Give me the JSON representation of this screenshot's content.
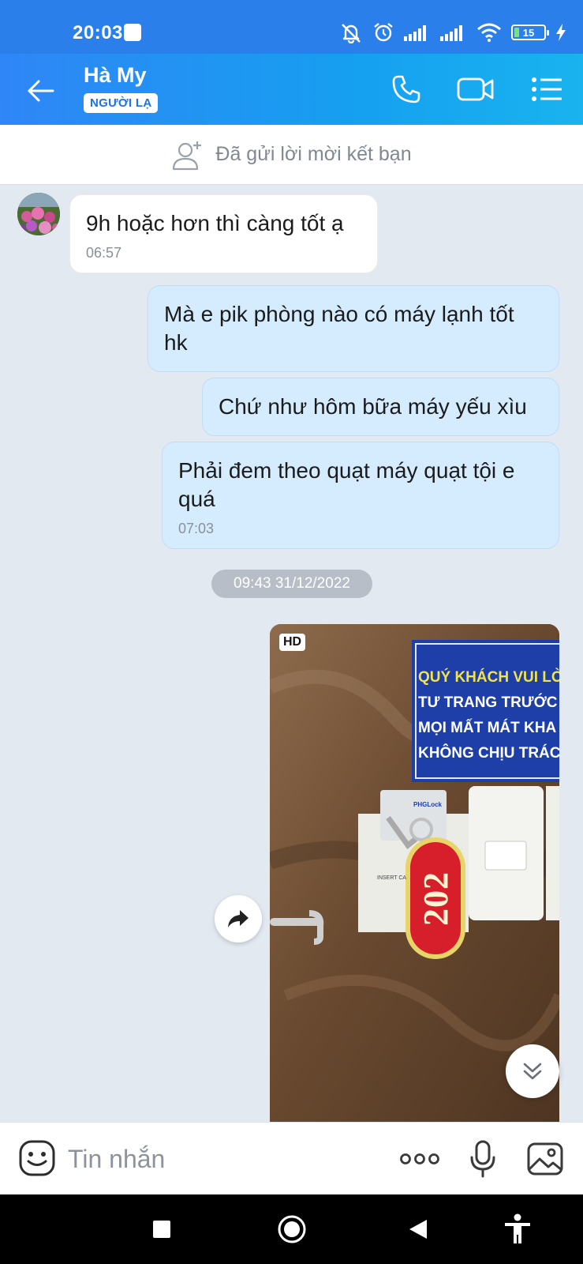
{
  "status_bar": {
    "time": "20:03",
    "battery_level": "15",
    "battery_fraction": 0.15,
    "icons": [
      "notifications-off-icon",
      "alarm-icon",
      "signal-icon",
      "signal-icon",
      "wifi-icon",
      "battery-icon",
      "charging-icon"
    ]
  },
  "header": {
    "contact_name": "Hà My",
    "badge": "NGƯỜI LẠ",
    "icons": [
      "back-arrow-icon",
      "phone-icon",
      "video-call-icon",
      "menu-list-icon"
    ]
  },
  "friend_request": {
    "text": "Đã gửi lời mời kết bạn",
    "icon": "add-friend-icon"
  },
  "messages": [
    {
      "direction": "incoming",
      "text": "9h hoặc hơn thì càng tốt ạ",
      "time": "06:57"
    },
    {
      "direction": "outgoing",
      "text": "Mà e pik phòng nào có máy lạnh tốt hk",
      "time": ""
    },
    {
      "direction": "outgoing",
      "text": "Chứ như hôm bữa máy yếu xìu",
      "time": ""
    },
    {
      "direction": "outgoing",
      "text": "Phải đem theo quạt máy quạt tội e quá",
      "time": "07:03"
    }
  ],
  "date_separator": "09:43 31/12/2022",
  "photo": {
    "hd_label": "HD",
    "sign_lines": [
      "QUÝ KHÁCH VUI LÒN",
      "TƯ TRANG TRƯỚC KHI",
      "MỌI MẤT MÁT KHA",
      "KHÔNG CHỊU TRÁC"
    ],
    "keycard_brand": "PHGLock",
    "keycard_slot_text": "INSERT CA",
    "key_tag_number": "202"
  },
  "input_bar": {
    "placeholder": "Tin nhắn",
    "icons": [
      "emoji-icon",
      "more-icon",
      "microphone-icon",
      "image-icon"
    ]
  },
  "nav_bar": {
    "icons": [
      "recents-icon",
      "home-icon",
      "back-icon",
      "accessibility-icon"
    ]
  },
  "colors": {
    "header_start": "#2f86f6",
    "header_end": "#19b3ef",
    "outgoing_bubble": "#d5ecff",
    "chat_background": "#e2e9f1"
  }
}
